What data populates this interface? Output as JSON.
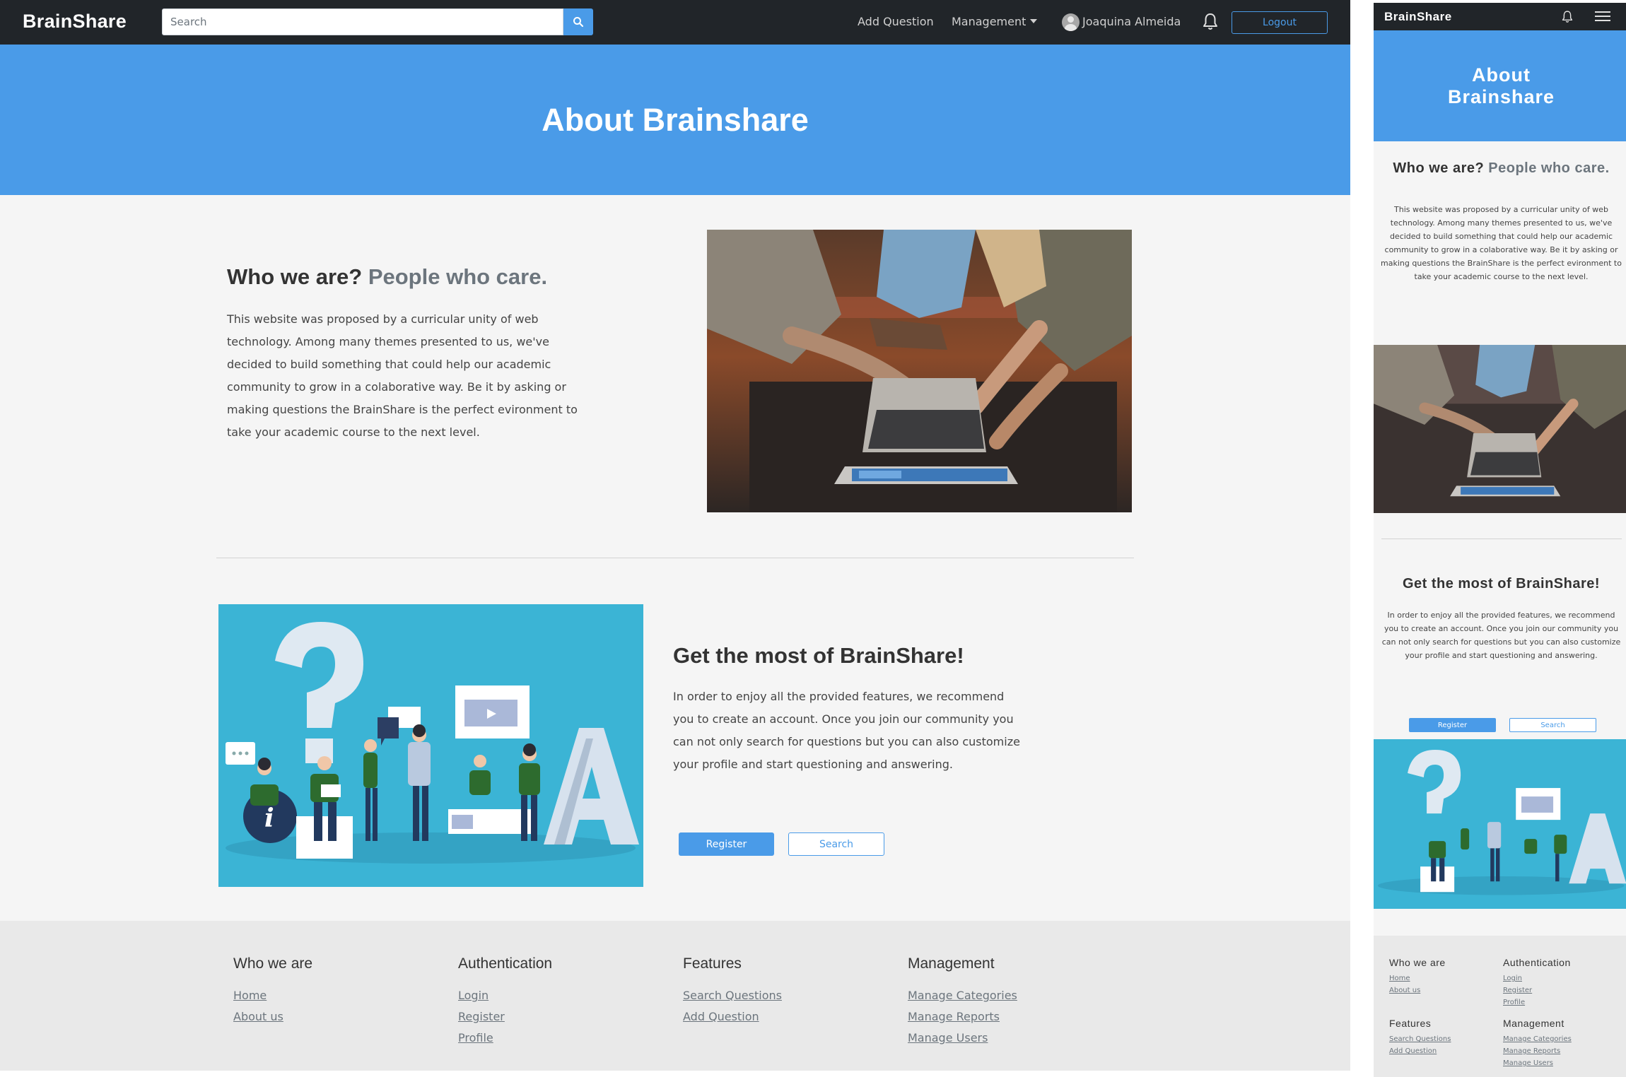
{
  "navbar": {
    "brand": "BrainShare",
    "search_placeholder": "Search",
    "add_question": "Add Question",
    "management": "Management",
    "username": "Joaquina Almeida",
    "logout": "Logout"
  },
  "hero": {
    "title": "About Brainshare"
  },
  "who": {
    "title_main": "Who we are?",
    "title_accent": "People who care.",
    "text": "This website was proposed by a curricular unity of web technology. Among many themes presented to us, we've decided to build something that could help our academic community to grow in a colaborative way. Be it by asking or making questions the BrainShare is the perfect evironment to take your academic course to the next level."
  },
  "most": {
    "title": "Get the most of BrainShare!",
    "text": "In order to enjoy all the provided features, we recommend you to create an account. Once you join our community you can not only search for questions but you can also customize your profile and start questioning and answering.",
    "register_label": "Register",
    "search_label": "Search"
  },
  "footer": {
    "who": {
      "title": "Who we are",
      "links": [
        "Home",
        "About us"
      ]
    },
    "auth": {
      "title": "Authentication",
      "links": [
        "Login",
        "Register",
        "Profile"
      ]
    },
    "features": {
      "title": "Features",
      "links": [
        "Search Questions",
        "Add Question"
      ]
    },
    "management": {
      "title": "Management",
      "links": [
        "Manage Categories",
        "Manage Reports",
        "Manage Users"
      ]
    }
  },
  "icons": {
    "search": "search-icon",
    "bell": "bell-icon",
    "menu": "hamburger-menu-icon",
    "avatar": "user-avatar-icon",
    "caret": "caret-down-icon"
  },
  "colors": {
    "navbar": "#212529",
    "primary": "#4a9be8",
    "illustration_bg": "#3bb4d5",
    "page_bg": "#f5f5f5",
    "footer_bg": "#e9e9e9",
    "muted": "#6c757d"
  }
}
